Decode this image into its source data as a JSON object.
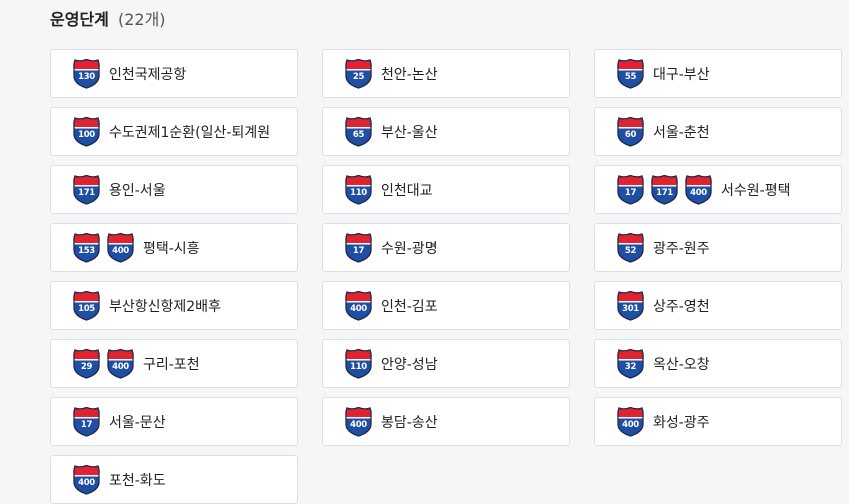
{
  "heading": {
    "title": "운영단계",
    "count": "(22개)"
  },
  "shield_colors": {
    "top": "#e0232e",
    "bottom": "#1f4fa3",
    "border": "#1b2a4a"
  },
  "routes": [
    {
      "name": "인천국제공항",
      "shields": [
        "130"
      ]
    },
    {
      "name": "천안-논산",
      "shields": [
        "25"
      ]
    },
    {
      "name": "대구-부산",
      "shields": [
        "55"
      ]
    },
    {
      "name": "수도권제1순환(일산-퇴계원",
      "shields": [
        "100"
      ]
    },
    {
      "name": "부산-울산",
      "shields": [
        "65"
      ]
    },
    {
      "name": "서울-춘천",
      "shields": [
        "60"
      ]
    },
    {
      "name": "용인-서울",
      "shields": [
        "171"
      ]
    },
    {
      "name": "인천대교",
      "shields": [
        "110"
      ]
    },
    {
      "name": "서수원-평택",
      "shields": [
        "17",
        "171",
        "400"
      ]
    },
    {
      "name": "평택-시흥",
      "shields": [
        "153",
        "400"
      ]
    },
    {
      "name": "수원-광명",
      "shields": [
        "17"
      ]
    },
    {
      "name": "광주-원주",
      "shields": [
        "52"
      ]
    },
    {
      "name": "부산항신항제2배후",
      "shields": [
        "105"
      ]
    },
    {
      "name": "인천-김포",
      "shields": [
        "400"
      ]
    },
    {
      "name": "상주-영천",
      "shields": [
        "301"
      ]
    },
    {
      "name": "구리-포천",
      "shields": [
        "29",
        "400"
      ]
    },
    {
      "name": "안양-성남",
      "shields": [
        "110"
      ]
    },
    {
      "name": "옥산-오창",
      "shields": [
        "32"
      ]
    },
    {
      "name": "서울-문산",
      "shields": [
        "17"
      ]
    },
    {
      "name": "봉담-송산",
      "shields": [
        "400"
      ]
    },
    {
      "name": "화성-광주",
      "shields": [
        "400"
      ]
    },
    {
      "name": "포천-화도",
      "shields": [
        "400"
      ]
    }
  ]
}
